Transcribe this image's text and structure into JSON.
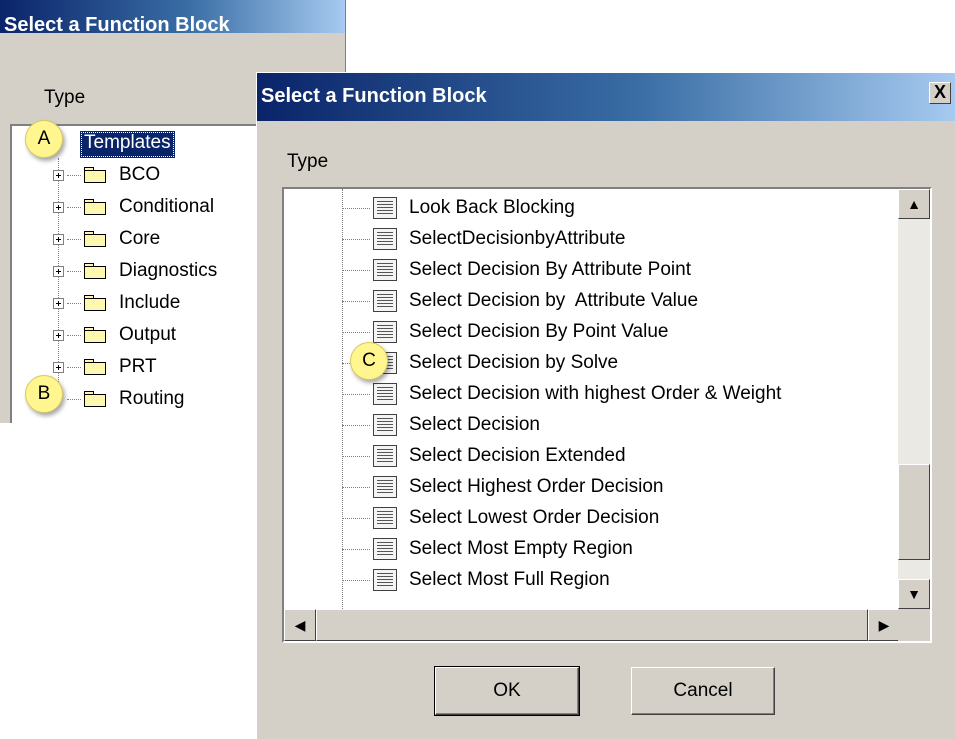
{
  "background_dialog": {
    "title": "Select a Function Block",
    "type_label": "Type",
    "tree": {
      "root": "Templates",
      "children": [
        "BCO",
        "Conditional",
        "Core",
        "Diagnostics",
        "Include",
        "Output",
        "PRT",
        "Routing"
      ]
    }
  },
  "foreground_dialog": {
    "title": "Select a Function Block",
    "close_label": "X",
    "type_label": "Type",
    "items": [
      "Look Back Blocking",
      "SelectDecisionbyAttribute",
      "Select Decision By Attribute Point",
      "Select Decision by  Attribute Value",
      "Select Decision By Point Value",
      "Select Decision by Solve",
      "Select Decision with highest Order & Weight",
      "Select Decision",
      "Select Decision Extended",
      "Select Highest Order Decision",
      "Select Lowest Order Decision",
      "Select Most Empty Region",
      "Select Most Full Region"
    ],
    "ok_label": "OK",
    "cancel_label": "Cancel"
  },
  "callouts": {
    "a": "A",
    "b": "B",
    "c": "C"
  },
  "icons": {
    "folder": "folder-icon",
    "function_block": "function-block-icon",
    "expand": "plus-expander-icon",
    "scroll_up": "▲",
    "scroll_down": "▼",
    "scroll_left": "◀",
    "scroll_right": "▶"
  },
  "colors": {
    "titlebar_start": "#0a246a",
    "titlebar_end": "#a6caf0",
    "selection": "#0a246a",
    "callout": "#fff68f",
    "dialog_face": "#d4d0c8"
  }
}
